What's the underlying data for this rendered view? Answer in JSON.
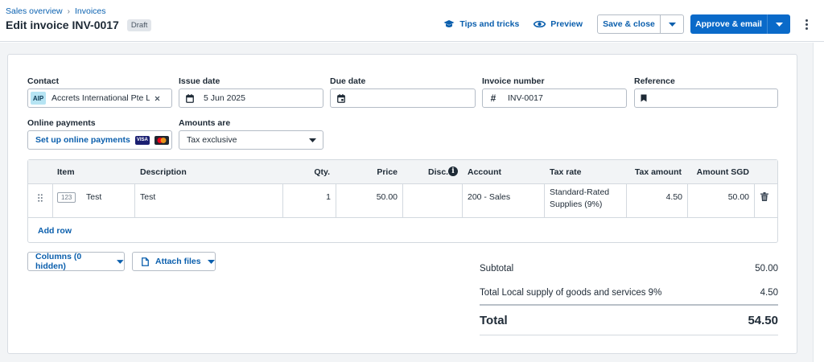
{
  "breadcrumb": {
    "items": [
      "Sales overview",
      "Invoices"
    ],
    "separator": "›"
  },
  "header": {
    "title": "Edit invoice INV-0017",
    "status_badge": "Draft"
  },
  "actions": {
    "tips_label": "Tips and tricks",
    "preview_label": "Preview",
    "save_close_label": "Save & close",
    "approve_label": "Approve & email"
  },
  "form": {
    "contact": {
      "label": "Contact",
      "initials": "AIP",
      "value": "Accrets International Pte Ltd"
    },
    "issue_date": {
      "label": "Issue date",
      "value": "5 Jun 2025"
    },
    "due_date": {
      "label": "Due date",
      "value": ""
    },
    "invoice_number": {
      "label": "Invoice number",
      "value": "INV-0017"
    },
    "reference": {
      "label": "Reference",
      "value": ""
    },
    "online_payments": {
      "label": "Online payments",
      "link": "Set up online payments",
      "card_visa": "VISA"
    },
    "amounts_are": {
      "label": "Amounts are",
      "value": "Tax exclusive"
    }
  },
  "table": {
    "columns": {
      "item": "Item",
      "description": "Description",
      "qty": "Qty.",
      "price": "Price",
      "disc": "Disc.",
      "account": "Account",
      "tax_rate": "Tax rate",
      "tax_amount": "Tax amount",
      "amount": "Amount SGD"
    },
    "rows": [
      {
        "item_code": "123",
        "item": "Test",
        "description": "Test",
        "qty": "1",
        "price": "50.00",
        "disc": "",
        "account": "200 - Sales",
        "tax_rate_line1": "Standard-Rated",
        "tax_rate_line2": "Supplies (9%)",
        "tax_amount": "4.50",
        "amount": "50.00"
      }
    ],
    "add_row_label": "Add row"
  },
  "footer": {
    "columns_btn": "Columns (0 hidden)",
    "attach_btn": "Attach files"
  },
  "totals": {
    "subtotal_label": "Subtotal",
    "subtotal": "50.00",
    "tax_label": "Total Local supply of goods and services 9%",
    "tax": "4.50",
    "total_label": "Total",
    "total": "54.50"
  },
  "colors": {
    "primary": "#0a6ac9",
    "link": "#0b5fad",
    "canvas": "#f2f4f6"
  }
}
